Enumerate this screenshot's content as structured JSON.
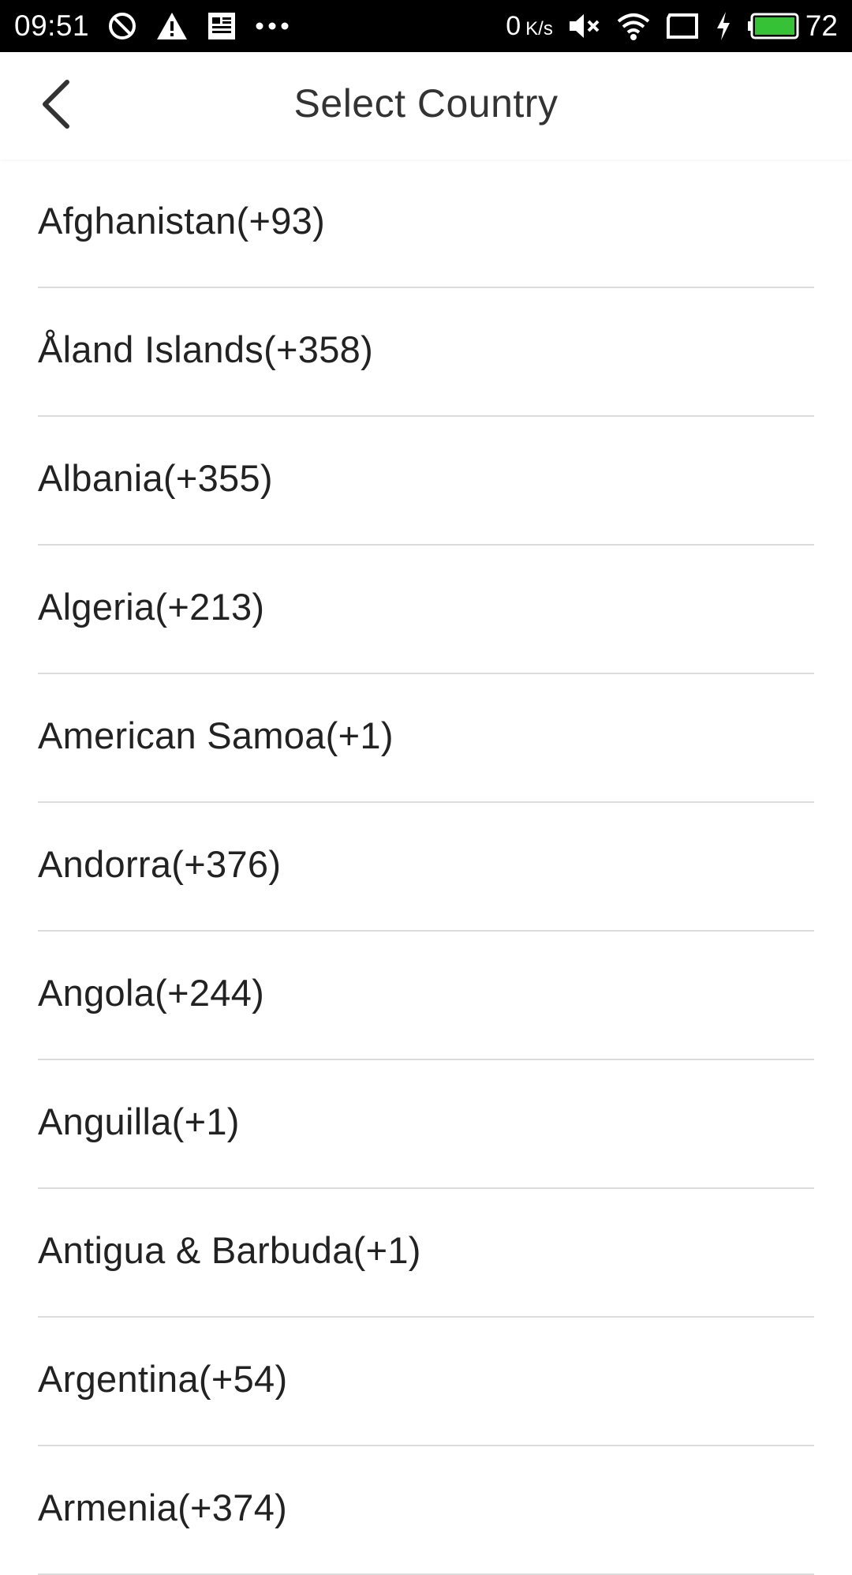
{
  "status_bar": {
    "time": "09:51",
    "speed_value": "0",
    "speed_unit": "K/s",
    "battery_percent": "72",
    "battery_color": "#36c136",
    "icons": [
      "do-not-disturb-icon",
      "warning-icon",
      "news-icon",
      "more-dots-icon",
      "mute-icon",
      "wifi-icon",
      "screen-icon",
      "charging-icon",
      "battery-icon"
    ]
  },
  "header": {
    "title": "Select Country",
    "back_icon": "chevron-left-icon"
  },
  "countries": [
    {
      "label": "Afghanistan(+93)"
    },
    {
      "label": "Åland Islands(+358)"
    },
    {
      "label": "Albania(+355)"
    },
    {
      "label": "Algeria(+213)"
    },
    {
      "label": "American Samoa(+1)"
    },
    {
      "label": "Andorra(+376)"
    },
    {
      "label": "Angola(+244)"
    },
    {
      "label": "Anguilla(+1)"
    },
    {
      "label": "Antigua & Barbuda(+1)"
    },
    {
      "label": "Argentina(+54)"
    },
    {
      "label": "Armenia(+374)"
    }
  ]
}
